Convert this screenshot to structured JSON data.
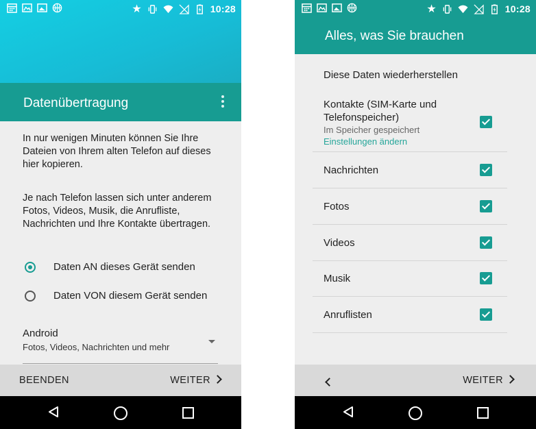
{
  "status_bar": {
    "time": "10:28",
    "left_icons": [
      "calendar-icon",
      "image-gallery-icon",
      "photo-icon",
      "basketball-icon"
    ],
    "right_icons": [
      "star-icon",
      "vibrate-icon",
      "wifi-icon",
      "no-sim-icon",
      "battery-charging-icon"
    ]
  },
  "left_screen": {
    "title": "Datenübertragung",
    "intro": "In nur wenigen Minuten können Sie Ihre Dateien von Ihrem alten Telefon auf dieses hier kopieren.",
    "detail": "Je nach Telefon lassen sich unter anderem Fotos, Videos, Musik, die Anrufliste, Nachrichten und Ihre Kontakte übertragen.",
    "options": [
      {
        "label": "Daten AN dieses Gerät senden",
        "selected": true
      },
      {
        "label": "Daten VON diesem Gerät senden",
        "selected": false
      }
    ],
    "source": {
      "title": "Android",
      "subtitle": "Fotos, Videos, Nachrichten und mehr"
    },
    "bottom": {
      "end_label": "BEENDEN",
      "next_label": "WEITER"
    }
  },
  "right_screen": {
    "title": "Alles, was Sie brauchen",
    "heading": "Diese Daten wiederherstellen",
    "items": [
      {
        "label": "Kontakte (SIM-Karte und Telefonspeicher)",
        "sublabel": "Im Speicher gespeichert",
        "link": "Einstellungen ändern",
        "checked": true
      },
      {
        "label": "Nachrichten",
        "checked": true
      },
      {
        "label": "Fotos",
        "checked": true
      },
      {
        "label": "Videos",
        "checked": true
      },
      {
        "label": "Musik",
        "checked": true
      },
      {
        "label": "Anruflisten",
        "checked": true
      }
    ],
    "bottom": {
      "next_label": "WEITER"
    }
  },
  "colors": {
    "accent": "#179c92",
    "hero": "#17c4dc",
    "link": "#26a69a",
    "bottom_bar": "#d9d9d9",
    "nav_bar": "#000000"
  }
}
